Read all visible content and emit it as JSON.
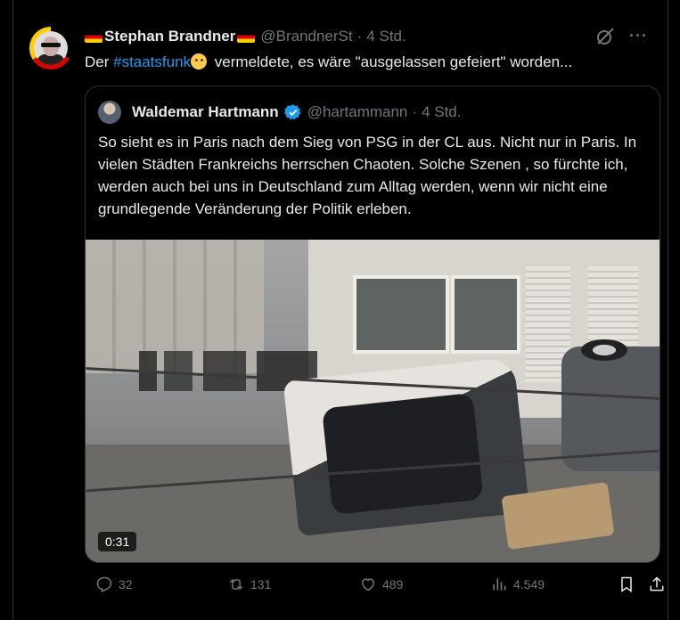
{
  "tweet": {
    "author_name": "Stephan Brandner",
    "handle": "@BrandnerSt",
    "separator": "·",
    "time": "4 Std.",
    "text_prefix": "Der ",
    "hashtag": "#staatsfunk",
    "text_suffix": " vermeldete, es wäre \"ausgelassen gefeiert\" worden...",
    "more": "···"
  },
  "quote": {
    "author_name": "Waldemar Hartmann",
    "handle": "@hartammann",
    "separator": "·",
    "time": "4 Std.",
    "text": "So sieht es in Paris nach dem Sieg von PSG in der CL aus. Nicht nur in Paris. In vielen Städten Frankreichs herrschen Chaoten. Solche Szenen , so fürchte ich, werden auch bei uns in Deutschland zum Alltag werden, wenn wir nicht eine grundlegende Veränderung der Politik erleben.",
    "video_duration": "0:31"
  },
  "actions": {
    "replies": "32",
    "reposts": "131",
    "likes": "489",
    "views": "4.549"
  },
  "colors": {
    "background": "#000000",
    "text": "#e7e9ea",
    "muted": "#71767b",
    "accent": "#1d9bf0",
    "border": "#2f3336"
  }
}
